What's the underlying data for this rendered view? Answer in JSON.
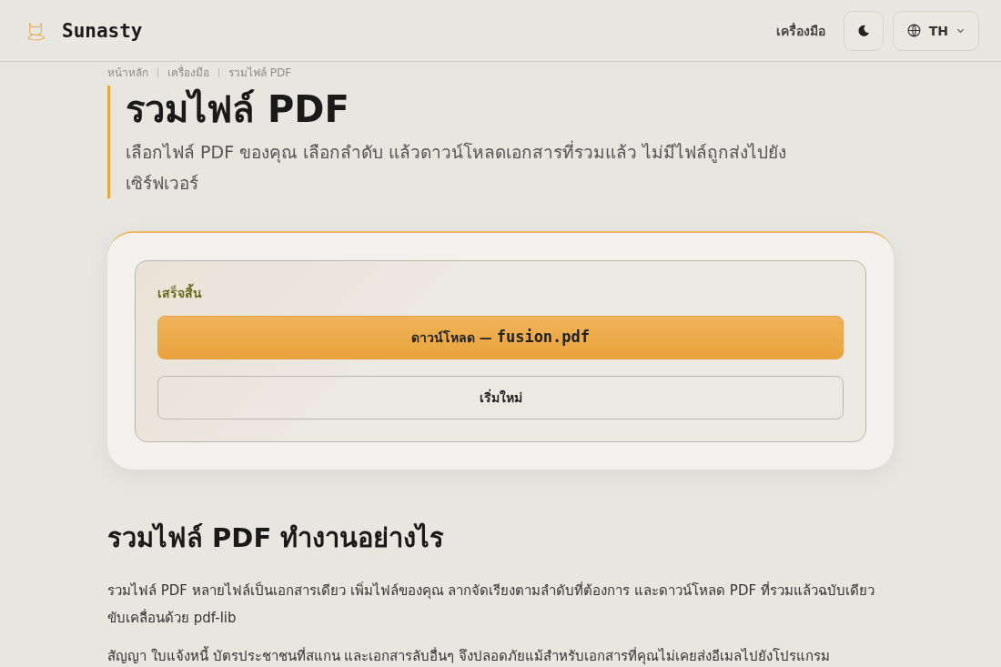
{
  "header": {
    "brand": "Sunasty",
    "nav_link": "เครื่องมือ",
    "language": "TH"
  },
  "breadcrumb": [
    "หน้าหลัก",
    "เครื่องมือ",
    "รวมไฟล์ PDF"
  ],
  "page": {
    "title": "รวมไฟล์ PDF",
    "subtitle": "เลือกไฟล์ PDF ของคุณ เลือกลำดับ แล้วดาวน์โหลดเอกสารที่รวมแล้ว ไม่มีไฟล์ถูกส่งไปยังเซิร์ฟเวอร์"
  },
  "result": {
    "status": "เสร็จสิ้น",
    "download_label": "ดาวน์โหลด —",
    "file_name": "fusion.pdf",
    "restart_label": "เริ่มใหม่"
  },
  "how_it_works": {
    "heading": "รวมไฟล์ PDF ทำงานอย่างไร",
    "paragraphs": [
      "รวมไฟล์ PDF หลายไฟล์เป็นเอกสารเดียว เพิ่มไฟล์ของคุณ ลากจัดเรียงตามลำดับที่ต้องการ และดาวน์โหลด PDF ที่รวมแล้วฉบับเดียว ขับเคลื่อนด้วย pdf-lib",
      "สัญญา ใบแจ้งหนี้ บัตรประชาชนที่สแกน และเอกสารลับอื่นๆ จึงปลอดภัยแม้สำหรับเอกสารที่คุณไม่เคยส่งอีเมลไปยังโปรแกรม"
    ]
  }
}
